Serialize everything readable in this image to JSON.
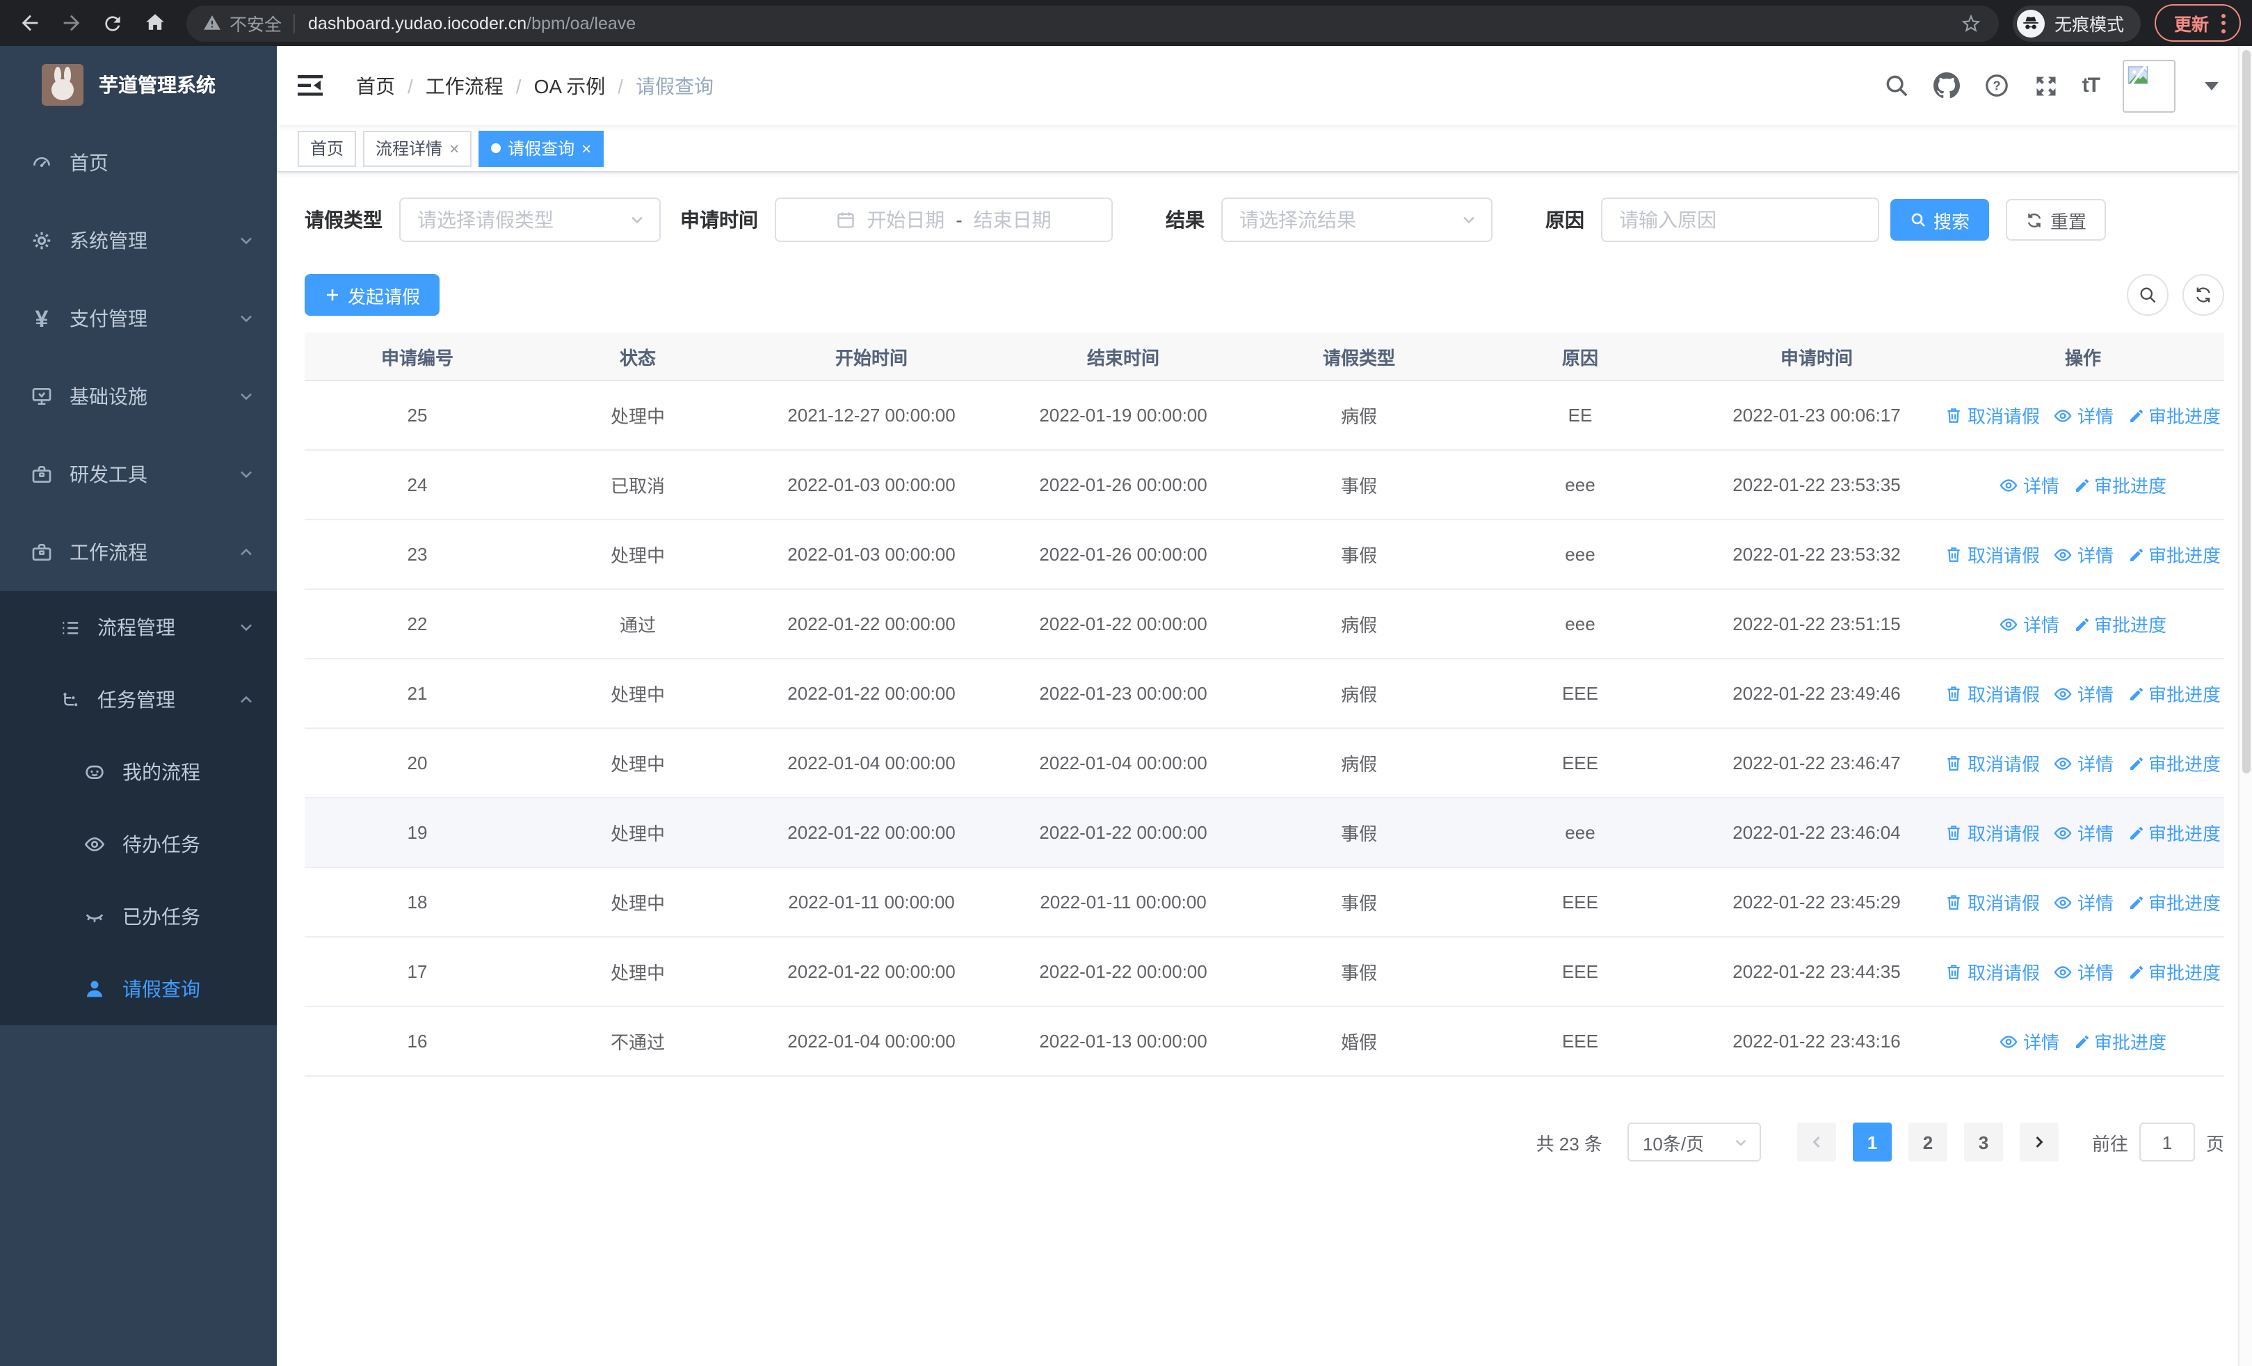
{
  "chrome": {
    "security_label": "不安全",
    "url_host": "dashboard.yudao.iocoder.cn",
    "url_path": "/bpm/oa/leave",
    "incognito_label": "无痕模式",
    "update_label": "更新"
  },
  "sidebar": {
    "title": "芋道管理系统",
    "menu": {
      "home": "首页",
      "system": "系统管理",
      "payment": "支付管理",
      "infra": "基础设施",
      "devtools": "研发工具",
      "workflow": "工作流程",
      "process_mgmt": "流程管理",
      "task_mgmt": "任务管理",
      "my_process": "我的流程",
      "todo_tasks": "待办任务",
      "done_tasks": "已办任务",
      "leave_query": "请假查询"
    }
  },
  "header": {
    "breadcrumb": [
      "首页",
      "工作流程",
      "OA 示例",
      "请假查询"
    ]
  },
  "tabs": [
    {
      "label": "首页",
      "active": false,
      "closable": false
    },
    {
      "label": "流程详情",
      "active": false,
      "closable": true
    },
    {
      "label": "请假查询",
      "active": true,
      "closable": true
    }
  ],
  "filters": {
    "type_label": "请假类型",
    "type_placeholder": "请选择请假类型",
    "time_label": "申请时间",
    "start_placeholder": "开始日期",
    "range_separator": "-",
    "end_placeholder": "结束日期",
    "result_label": "结果",
    "result_placeholder": "请选择流结果",
    "reason_label": "原因",
    "reason_placeholder": "请输入原因",
    "search_label": "搜索",
    "reset_label": "重置"
  },
  "toolbar": {
    "create_label": "发起请假"
  },
  "table": {
    "headers": [
      "申请编号",
      "状态",
      "开始时间",
      "结束时间",
      "请假类型",
      "原因",
      "申请时间",
      "操作"
    ],
    "action_labels": {
      "cancel": "取消请假",
      "detail": "详情",
      "progress": "审批进度"
    },
    "rows": [
      {
        "id": "25",
        "status": "处理中",
        "start": "2021-12-27 00:00:00",
        "end": "2022-01-19 00:00:00",
        "type": "病假",
        "reason": "EE",
        "apply_time": "2022-01-23 00:06:17",
        "actions": [
          "cancel",
          "detail",
          "progress"
        ],
        "highlight": false
      },
      {
        "id": "24",
        "status": "已取消",
        "start": "2022-01-03 00:00:00",
        "end": "2022-01-26 00:00:00",
        "type": "事假",
        "reason": "eee",
        "apply_time": "2022-01-22 23:53:35",
        "actions": [
          "detail",
          "progress"
        ],
        "highlight": false
      },
      {
        "id": "23",
        "status": "处理中",
        "start": "2022-01-03 00:00:00",
        "end": "2022-01-26 00:00:00",
        "type": "事假",
        "reason": "eee",
        "apply_time": "2022-01-22 23:53:32",
        "actions": [
          "cancel",
          "detail",
          "progress"
        ],
        "highlight": false
      },
      {
        "id": "22",
        "status": "通过",
        "start": "2022-01-22 00:00:00",
        "end": "2022-01-22 00:00:00",
        "type": "病假",
        "reason": "eee",
        "apply_time": "2022-01-22 23:51:15",
        "actions": [
          "detail",
          "progress"
        ],
        "highlight": false
      },
      {
        "id": "21",
        "status": "处理中",
        "start": "2022-01-22 00:00:00",
        "end": "2022-01-23 00:00:00",
        "type": "病假",
        "reason": "EEE",
        "apply_time": "2022-01-22 23:49:46",
        "actions": [
          "cancel",
          "detail",
          "progress"
        ],
        "highlight": false
      },
      {
        "id": "20",
        "status": "处理中",
        "start": "2022-01-04 00:00:00",
        "end": "2022-01-04 00:00:00",
        "type": "病假",
        "reason": "EEE",
        "apply_time": "2022-01-22 23:46:47",
        "actions": [
          "cancel",
          "detail",
          "progress"
        ],
        "highlight": false
      },
      {
        "id": "19",
        "status": "处理中",
        "start": "2022-01-22 00:00:00",
        "end": "2022-01-22 00:00:00",
        "type": "事假",
        "reason": "eee",
        "apply_time": "2022-01-22 23:46:04",
        "actions": [
          "cancel",
          "detail",
          "progress"
        ],
        "highlight": true
      },
      {
        "id": "18",
        "status": "处理中",
        "start": "2022-01-11 00:00:00",
        "end": "2022-01-11 00:00:00",
        "type": "事假",
        "reason": "EEE",
        "apply_time": "2022-01-22 23:45:29",
        "actions": [
          "cancel",
          "detail",
          "progress"
        ],
        "highlight": false
      },
      {
        "id": "17",
        "status": "处理中",
        "start": "2022-01-22 00:00:00",
        "end": "2022-01-22 00:00:00",
        "type": "事假",
        "reason": "EEE",
        "apply_time": "2022-01-22 23:44:35",
        "actions": [
          "cancel",
          "detail",
          "progress"
        ],
        "highlight": false
      },
      {
        "id": "16",
        "status": "不通过",
        "start": "2022-01-04 00:00:00",
        "end": "2022-01-13 00:00:00",
        "type": "婚假",
        "reason": "EEE",
        "apply_time": "2022-01-22 23:43:16",
        "actions": [
          "detail",
          "progress"
        ],
        "highlight": false
      }
    ]
  },
  "pagination": {
    "total_text": "共 23 条",
    "page_size": "10条/页",
    "pages": [
      "1",
      "2",
      "3"
    ],
    "active_page": "1",
    "goto_label": "前往",
    "goto_value": "1",
    "goto_unit": "页"
  },
  "icons": {
    "close": "×",
    "help_glyph": "?",
    "font_size_glyph": "tT",
    "yen_glyph": "¥",
    "breadcrumb_separator": "/"
  },
  "colors": {
    "accent": "#409eff",
    "sidebar_bg": "#304156",
    "submenu_bg": "#1f2d3d",
    "chrome_bg": "#202124",
    "update_accent": "#f28b82"
  }
}
